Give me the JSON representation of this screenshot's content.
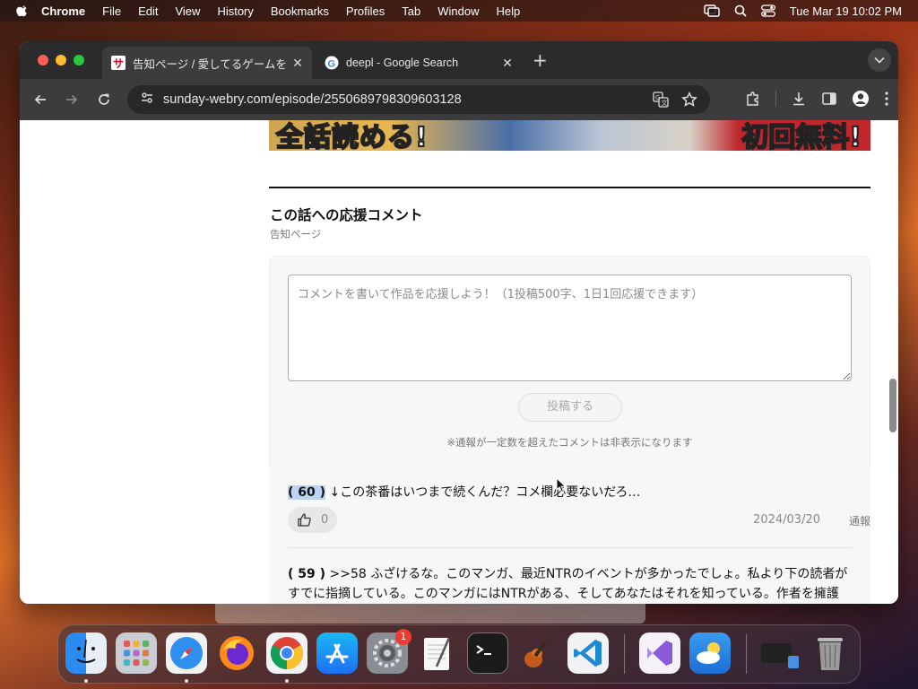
{
  "menubar": {
    "app": "Chrome",
    "items": [
      "File",
      "Edit",
      "View",
      "History",
      "Bookmarks",
      "Profiles",
      "Tab",
      "Window",
      "Help"
    ],
    "datetime": "Tue Mar 19  10:02 PM"
  },
  "browser": {
    "tabs": [
      {
        "title": "告知ページ / 愛してるゲームを",
        "active": true
      },
      {
        "title": "deepl - Google Search",
        "active": false
      }
    ],
    "url": "sunday-webry.com/episode/2550689798309603128"
  },
  "page": {
    "banner_left": "全話読める!",
    "banner_right": "初回無料!",
    "section_title": "この話への応援コメント",
    "section_subtitle": "告知ページ",
    "comment_placeholder": "コメントを書いて作品を応援しよう！（1投稿500字、1日1回応援できます）",
    "post_button": "投稿する",
    "notice": "※通報が一定数を超えたコメントは非表示になります",
    "comments": [
      {
        "number": "( 60 )",
        "text": " ↓この茶番はいつまで続くんだ？コメ欄必要ないだろ…",
        "likes": "0",
        "date": "2024/03/20",
        "report": "通報"
      },
      {
        "number": "( 59 )",
        "text": " >>58 ふざけるな。このマンガ、最近NTRのイベントが多かったでしょ。私より下の読者がすでに指摘している。このマンガにはNTRがある、そしてあなたはそれを知っている。作者を擁護"
      }
    ]
  },
  "colors": {
    "tab_bg": "#2b2b2d",
    "toolbar_bg": "#3c3c3e",
    "highlight": "#bcd4f2"
  }
}
